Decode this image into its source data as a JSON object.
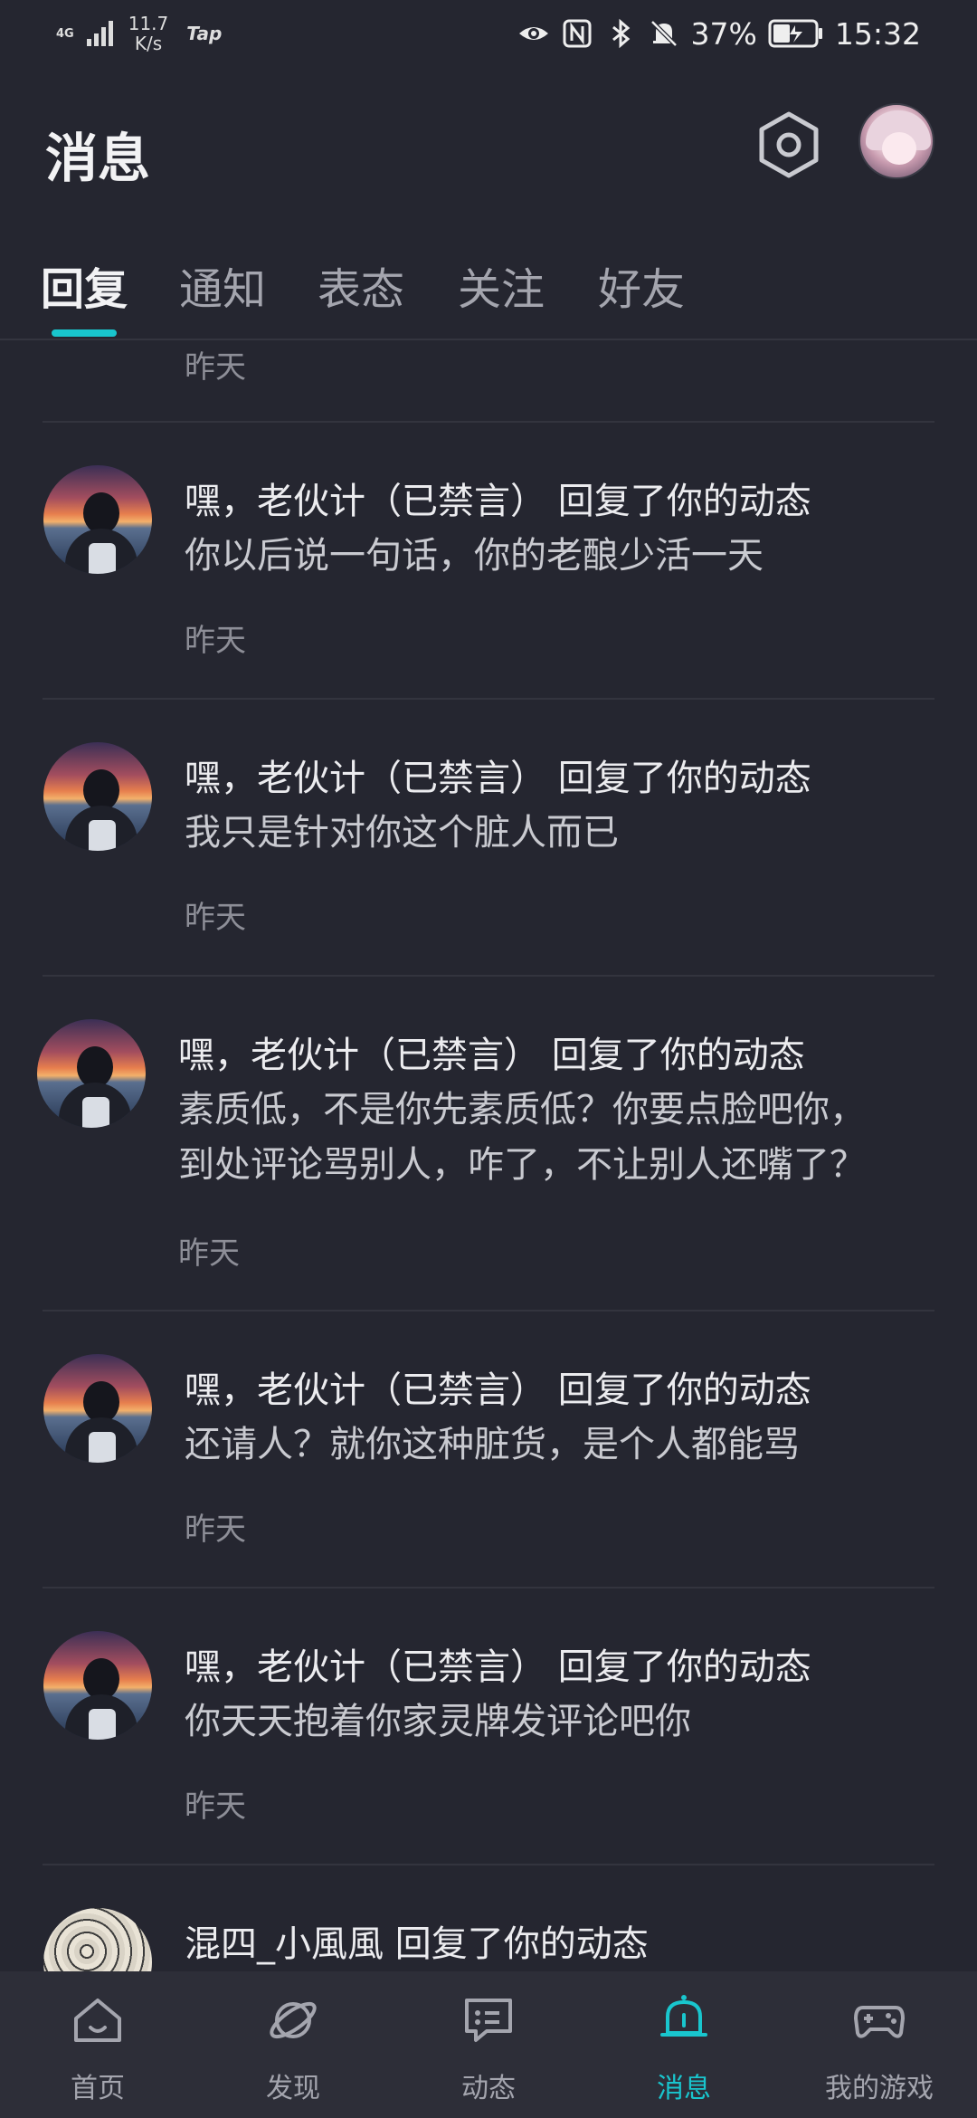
{
  "status_bar": {
    "network": "4G",
    "speed_value": "11.7",
    "speed_unit": "K/s",
    "app_badge": "Tap",
    "battery": "37%",
    "time": "15:32"
  },
  "header": {
    "title": "消息"
  },
  "tabs": [
    {
      "label": "回复",
      "active": true
    },
    {
      "label": "通知",
      "active": false
    },
    {
      "label": "表态",
      "active": false
    },
    {
      "label": "关注",
      "active": false
    },
    {
      "label": "好友",
      "active": false
    }
  ],
  "list": {
    "partial_time": "昨天",
    "items": [
      {
        "title": "嘿，老伙计（已禁言） 回复了你的动态",
        "content": "你以后说一句话，你的老酿少活一天",
        "time": "昨天"
      },
      {
        "title": "嘿，老伙计（已禁言） 回复了你的动态",
        "content": "我只是针对你这个脏人而已",
        "time": "昨天"
      },
      {
        "title": "嘿，老伙计（已禁言） 回复了你的动态",
        "content_lines": [
          "素质低，不是你先素质低？你要点脸吧你，",
          "到处评论骂别人，咋了，不让别人还嘴了？"
        ],
        "time": "昨天"
      },
      {
        "title": "嘿，老伙计（已禁言） 回复了你的动态",
        "content": "还请人？就你这种脏货，是个人都能骂",
        "time": "昨天"
      },
      {
        "title": "嘿，老伙计（已禁言） 回复了你的动态",
        "content": "你天天抱着你家灵牌发评论吧你",
        "time": "昨天"
      },
      {
        "title": "混四_小風風 回复了你的动态"
      }
    ]
  },
  "bottom_nav": [
    {
      "label": "首页",
      "icon": "home-icon",
      "active": false
    },
    {
      "label": "发现",
      "icon": "planet-icon",
      "active": false
    },
    {
      "label": "动态",
      "icon": "chat-icon",
      "active": false
    },
    {
      "label": "消息",
      "icon": "bell-icon",
      "active": true
    },
    {
      "label": "我的游戏",
      "icon": "gamepad-icon",
      "active": false
    }
  ],
  "colors": {
    "background": "#252630",
    "accent": "#19C6CE",
    "nav_background": "#2D2E38",
    "secondary_text": "#8D8E97"
  }
}
